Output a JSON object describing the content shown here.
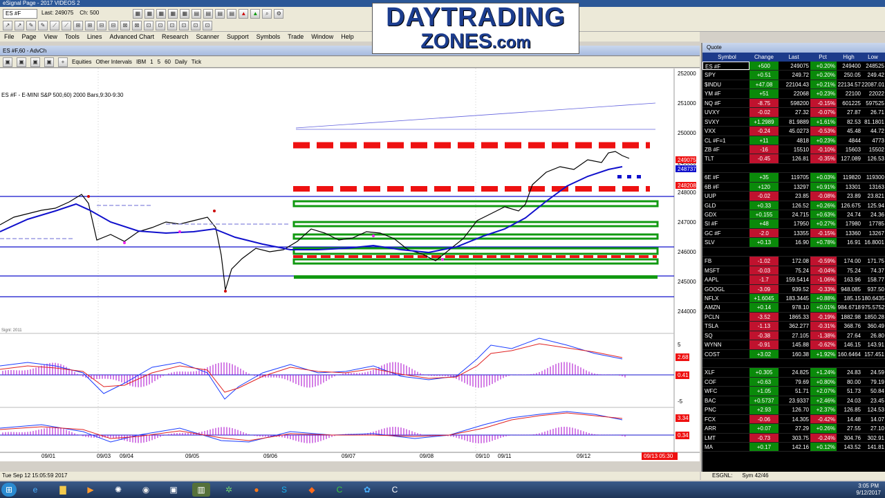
{
  "window": {
    "title": "eSignal Page - 2017 VIDEOS 2"
  },
  "toolbar": {
    "symbol": "ES #F",
    "last_label": "Last: 249075",
    "ch_label": "Ch: 500"
  },
  "menu": [
    "File",
    "Page",
    "View",
    "Tools",
    "Lines",
    "Advanced Chart",
    "Research",
    "Scanner",
    "Support",
    "Symbols",
    "Trade",
    "Window",
    "Help"
  ],
  "chart": {
    "window_title": "ES #F,60 - AdvCh",
    "tb_items": [
      "Equities",
      "Other Intervals",
      "IBM",
      "1",
      "5",
      "60",
      "Daily",
      "Tick"
    ],
    "title": "ES #F - E-MINI S&P 500,60) 2000 Bars,9:30-9:30",
    "price_labels": [
      "252000",
      "251000",
      "250000",
      "249000",
      "248000",
      "247000",
      "246000",
      "245000",
      "244000"
    ],
    "last_price_tag": "249075",
    "second_price_tag": "248737",
    "third_price_tag": "248208",
    "date_labels": [
      "09/01",
      "09/03",
      "09/04",
      "09/05",
      "09/06",
      "09/07",
      "09/08",
      "09/10",
      "09/11",
      "09/12"
    ],
    "current_time_tag": "09/13 05:30",
    "study_label": "Signl: 2011",
    "osc1_tags": [
      "5",
      "2.68",
      "0.41",
      "-5"
    ],
    "osc2_tags": [
      "3.34",
      "0.34"
    ],
    "status": "Tue Sep 12 15:05:59 2017"
  },
  "logo": {
    "line1": "DAYTRADING",
    "line2": "ZONES",
    "line2_suffix": ".com"
  },
  "quote": {
    "title": "Quote",
    "headers": [
      "Symbol",
      "Change",
      "Last",
      "Pct",
      "High",
      "Low"
    ],
    "rows": [
      {
        "s": "ES #F",
        "c": "+500",
        "l": "249075",
        "p": "+0.20%",
        "h": "249400",
        "w": "248525",
        "d": "up"
      },
      {
        "s": "SPY",
        "c": "+0.51",
        "l": "249.72",
        "p": "+0.20%",
        "h": "250.05",
        "w": "249.42",
        "d": "up"
      },
      {
        "s": "$INDU",
        "c": "+47.08",
        "l": "22104.43",
        "p": "+0.21%",
        "h": "22134.57",
        "w": "22087.01",
        "d": "up"
      },
      {
        "s": "YM #F",
        "c": "+51",
        "l": "22068",
        "p": "+0.23%",
        "h": "22100",
        "w": "22022",
        "d": "up"
      },
      {
        "s": "NQ #F",
        "c": "-8.75",
        "l": "598200",
        "p": "-0.15%",
        "h": "601225",
        "w": "597525",
        "d": "dn"
      },
      {
        "s": "UVXY",
        "c": "-0.02",
        "l": "27.32",
        "p": "-0.07%",
        "h": "27.87",
        "w": "26.71",
        "d": "dn"
      },
      {
        "s": "SVXY",
        "c": "+1.2989",
        "l": "81.9889",
        "p": "+1.61%",
        "h": "82.53",
        "w": "81.1801",
        "d": "up"
      },
      {
        "s": "VXX",
        "c": "-0.24",
        "l": "45.0273",
        "p": "-0.53%",
        "h": "45.48",
        "w": "44.72",
        "d": "dn"
      },
      {
        "s": "CL #F=1",
        "c": "+11",
        "l": "4818",
        "p": "+0.23%",
        "h": "4844",
        "w": "4773",
        "d": "up"
      },
      {
        "s": "ZB #F",
        "c": "-16",
        "l": "15510",
        "p": "-0.10%",
        "h": "15603",
        "w": "15502",
        "d": "dn"
      },
      {
        "s": "TLT",
        "c": "-0.45",
        "l": "126.81",
        "p": "-0.35%",
        "h": "127.089",
        "w": "126.53",
        "d": "dn"
      },
      {
        "s": "",
        "c": "",
        "l": "",
        "p": "",
        "h": "",
        "w": "",
        "d": "blank"
      },
      {
        "s": "6E #F",
        "c": "+35",
        "l": "119705",
        "p": "+0.03%",
        "h": "119820",
        "w": "119300",
        "d": "up"
      },
      {
        "s": "6B #F",
        "c": "+120",
        "l": "13297",
        "p": "+0.91%",
        "h": "13301",
        "w": "13163",
        "d": "up"
      },
      {
        "s": "UUP",
        "c": "-0.02",
        "l": "23.85",
        "p": "-0.08%",
        "h": "23.89",
        "w": "23.821",
        "d": "dn"
      },
      {
        "s": "GLD",
        "c": "+0.33",
        "l": "126.52",
        "p": "+0.26%",
        "h": "126.675",
        "w": "125.94",
        "d": "up"
      },
      {
        "s": "GDX",
        "c": "+0.155",
        "l": "24.715",
        "p": "+0.63%",
        "h": "24.74",
        "w": "24.36",
        "d": "up"
      },
      {
        "s": "SI #F",
        "c": "+48",
        "l": "17950",
        "p": "+0.27%",
        "h": "17980",
        "w": "17785",
        "d": "up"
      },
      {
        "s": "GC #F",
        "c": "-2.0",
        "l": "13355",
        "p": "-0.15%",
        "h": "13360",
        "w": "13267",
        "d": "dn"
      },
      {
        "s": "SLV",
        "c": "+0.13",
        "l": "16.90",
        "p": "+0.78%",
        "h": "16.91",
        "w": "16.8001",
        "d": "up"
      },
      {
        "s": "",
        "c": "",
        "l": "",
        "p": "",
        "h": "",
        "w": "",
        "d": "blank"
      },
      {
        "s": "FB",
        "c": "-1.02",
        "l": "172.08",
        "p": "-0.59%",
        "h": "174.00",
        "w": "171.75",
        "d": "dn"
      },
      {
        "s": "MSFT",
        "c": "-0.03",
        "l": "75.24",
        "p": "-0.04%",
        "h": "75.24",
        "w": "74.37",
        "d": "dn"
      },
      {
        "s": "AAPL",
        "c": "-1.7",
        "l": "159.5414",
        "p": "-1.06%",
        "h": "163.96",
        "w": "158.77",
        "d": "dn"
      },
      {
        "s": "GOOGL",
        "c": "-3.09",
        "l": "939.52",
        "p": "-0.33%",
        "h": "948.085",
        "w": "937.50",
        "d": "dn"
      },
      {
        "s": "NFLX",
        "c": "+1.6045",
        "l": "183.3445",
        "p": "+0.88%",
        "h": "185.15",
        "w": "180.6435",
        "d": "up"
      },
      {
        "s": "AMZN",
        "c": "+0.14",
        "l": "978.10",
        "p": "+0.01%",
        "h": "984.6718",
        "w": "975.5752",
        "d": "up"
      },
      {
        "s": "PCLN",
        "c": "-3.52",
        "l": "1865.33",
        "p": "-0.19%",
        "h": "1882.98",
        "w": "1850.28",
        "d": "dn"
      },
      {
        "s": "TSLA",
        "c": "-1.13",
        "l": "362.277",
        "p": "-0.31%",
        "h": "368.76",
        "w": "360.49",
        "d": "dn"
      },
      {
        "s": "SQ",
        "c": "-0.38",
        "l": "27.105",
        "p": "-1.38%",
        "h": "27.64",
        "w": "26.80",
        "d": "dn"
      },
      {
        "s": "WYNN",
        "c": "-0.91",
        "l": "145.88",
        "p": "-0.62%",
        "h": "146.15",
        "w": "143.91",
        "d": "dn"
      },
      {
        "s": "COST",
        "c": "+3.02",
        "l": "160.38",
        "p": "+1.92%",
        "h": "160.6464",
        "w": "157.451",
        "d": "up"
      },
      {
        "s": "",
        "c": "",
        "l": "",
        "p": "",
        "h": "",
        "w": "",
        "d": "blank"
      },
      {
        "s": "XLF",
        "c": "+0.305",
        "l": "24.825",
        "p": "+1.24%",
        "h": "24.83",
        "w": "24.59",
        "d": "up"
      },
      {
        "s": "COF",
        "c": "+0.63",
        "l": "79.69",
        "p": "+0.80%",
        "h": "80.00",
        "w": "79.19",
        "d": "up"
      },
      {
        "s": "WFC",
        "c": "+1.05",
        "l": "51.71",
        "p": "+2.07%",
        "h": "51.73",
        "w": "50.84",
        "d": "up"
      },
      {
        "s": "BAC",
        "c": "+0.5737",
        "l": "23.9337",
        "p": "+2.46%",
        "h": "24.03",
        "w": "23.45",
        "d": "up"
      },
      {
        "s": "PNC",
        "c": "+2.93",
        "l": "126.70",
        "p": "+2.37%",
        "h": "126.85",
        "w": "124.53",
        "d": "up"
      },
      {
        "s": "FCX",
        "c": "-0.06",
        "l": "14.305",
        "p": "-0.42%",
        "h": "14.48",
        "w": "14.07",
        "d": "dn"
      },
      {
        "s": "ARR",
        "c": "+0.07",
        "l": "27.29",
        "p": "+0.26%",
        "h": "27.55",
        "w": "27.10",
        "d": "up"
      },
      {
        "s": "LMT",
        "c": "-0.73",
        "l": "303.75",
        "p": "-0.24%",
        "h": "304.76",
        "w": "302.91",
        "d": "dn"
      },
      {
        "s": "MA",
        "c": "+0.17",
        "l": "142.16",
        "p": "+0.12%",
        "h": "143.52",
        "w": "141.81",
        "d": "up"
      }
    ],
    "status": [
      "ESGNL:",
      "Sym 42/46"
    ]
  },
  "taskbar": {
    "time": "3:05 PM",
    "date": "9/12/2017"
  },
  "colors": {
    "resistance": "#ee1111",
    "support": "#119911",
    "ma_line": "#1010cc",
    "up_bg": "#0a8a0a",
    "down_bg": "#c0122e"
  }
}
